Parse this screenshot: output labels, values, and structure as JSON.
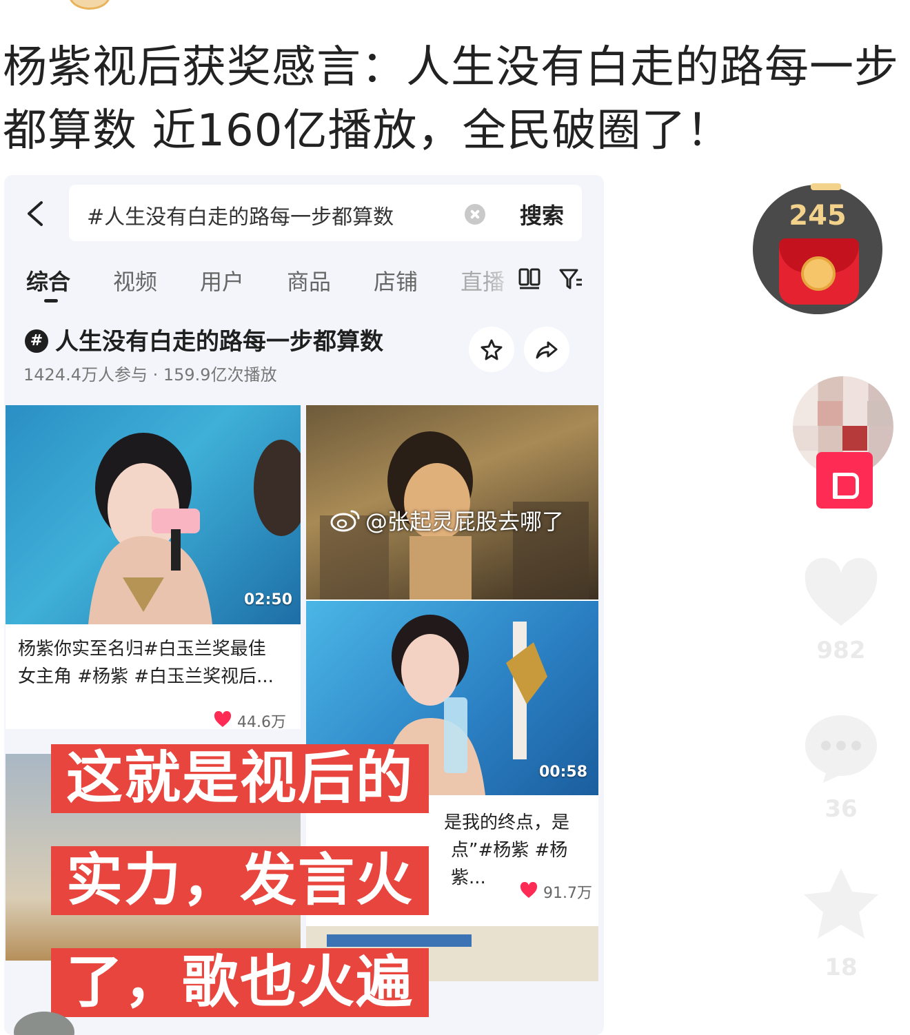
{
  "headline": "杨紫视后获奖感言：人生没有白走的路每一步都算数 近160亿播放，全民破圈了！",
  "search": {
    "query": "#人生没有白走的路每一步都算数",
    "button": "搜索"
  },
  "tabs": [
    {
      "label": "综合",
      "active": true
    },
    {
      "label": "视频"
    },
    {
      "label": "用户"
    },
    {
      "label": "商品"
    },
    {
      "label": "店铺"
    },
    {
      "label": "直播"
    }
  ],
  "topic": {
    "icon_char": "#",
    "title": "人生没有白走的路每一步都算数",
    "stats": "1424.4万人参与 · 159.9亿次播放"
  },
  "cards": [
    {
      "duration": "02:50",
      "caption_line1": "杨紫你实至名归#白玉兰奖最佳",
      "caption_line2": "女主角 #杨紫 #白玉兰奖视后...",
      "likes": "44.6万"
    },
    {
      "duration": "00:58",
      "caption_line1": "是我的终点，是",
      "caption_line2": "点”#杨紫 #杨紫...",
      "likes": "91.7万"
    }
  ],
  "watermark": "@张起灵屁股去哪了",
  "overlay_lines": [
    "这就是视后的",
    "实力，发言火",
    "了，歌也火遍"
  ],
  "rail": {
    "coin_value": "245",
    "like_count": "982",
    "comment_count": "36",
    "favorite_count": "18"
  },
  "colors": {
    "overlay_red": "#e7453d",
    "heart_red": "#fe2c55",
    "coin_gold": "#f3d28b"
  },
  "icons": [
    "back-icon",
    "clear-icon",
    "grid-icon",
    "filter-icon",
    "star-icon",
    "share-icon",
    "heart-icon",
    "comment-icon",
    "weibo-icon",
    "red-packet-icon"
  ]
}
